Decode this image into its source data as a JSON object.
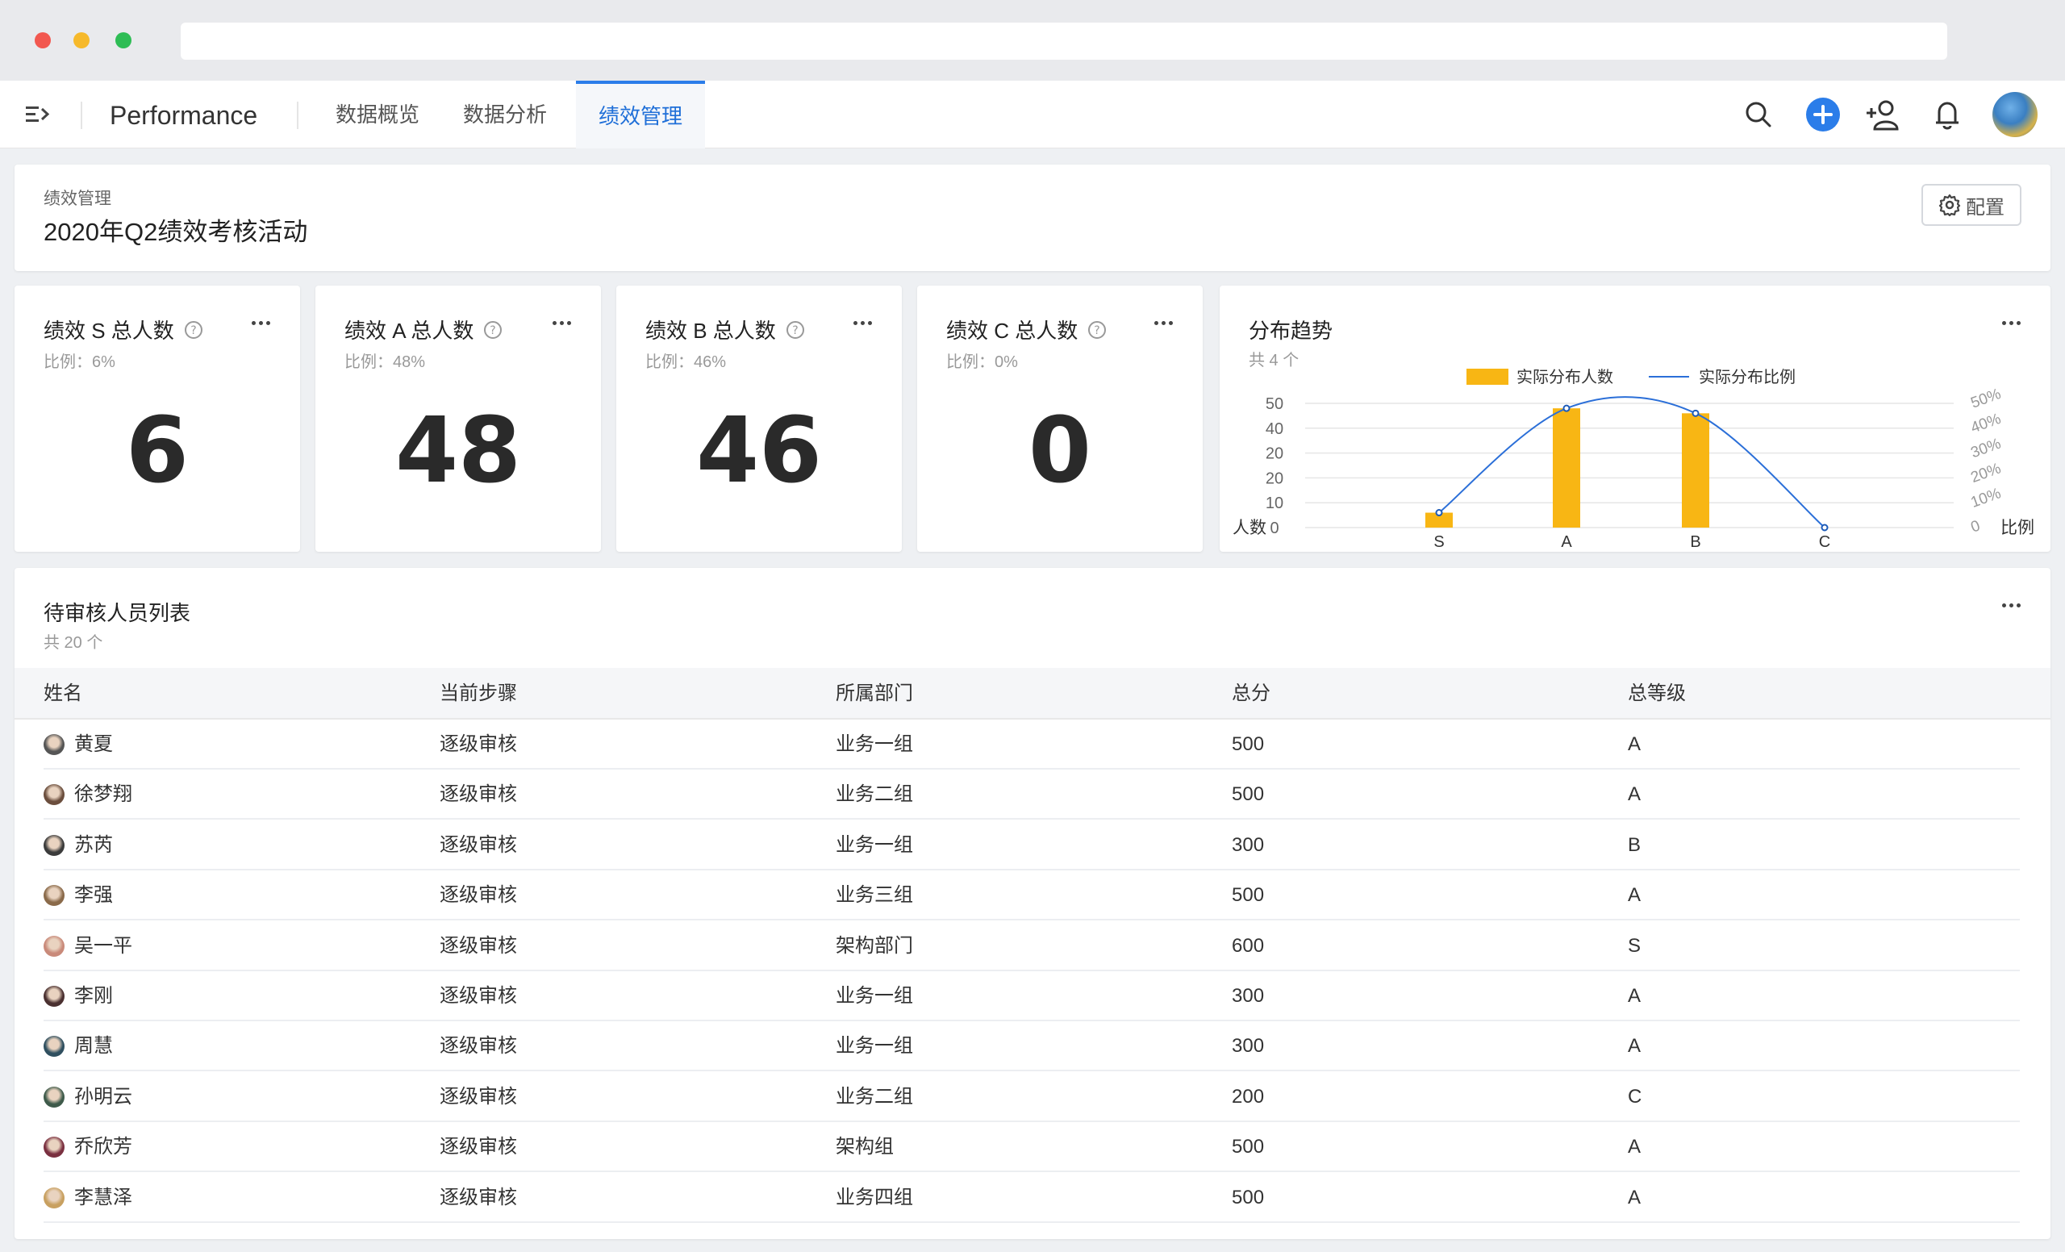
{
  "nav": {
    "brand": "Performance",
    "tabs": [
      {
        "label": "数据概览"
      },
      {
        "label": "数据分析"
      },
      {
        "label": "绩效管理",
        "active": true
      }
    ],
    "icons": [
      "search-icon",
      "add-icon",
      "add-user-icon",
      "bell-icon",
      "user-avatar"
    ]
  },
  "header": {
    "breadcrumb": "绩效管理",
    "title": "2020年Q2绩效考核活动",
    "config_label": "配置"
  },
  "stats": [
    {
      "title": "绩效 S 总人数",
      "sub": "比例：6%",
      "value": "6"
    },
    {
      "title": "绩效 A 总人数",
      "sub": "比例：48%",
      "value": "48"
    },
    {
      "title": "绩效 B 总人数",
      "sub": "比例：46%",
      "value": "46"
    },
    {
      "title": "绩效 C 总人数",
      "sub": "比例：0%",
      "value": "0"
    }
  ],
  "chart_card": {
    "title": "分布趋势",
    "sub": "共 4 个"
  },
  "chart_data": {
    "type": "bar",
    "categories": [
      "S",
      "A",
      "B",
      "C"
    ],
    "series": [
      {
        "name": "实际分布人数",
        "type": "bar",
        "values": [
          6,
          48,
          46,
          0
        ],
        "color": "#f8b614",
        "axis": "left"
      },
      {
        "name": "实际分布比例",
        "type": "line",
        "values": [
          0.06,
          0.48,
          0.46,
          0
        ],
        "color": "#2b6fd8",
        "axis": "right"
      }
    ],
    "ylabel": "人数",
    "y2label": "比例",
    "ylim": [
      0,
      50
    ],
    "yticks": [
      "0",
      "10",
      "20",
      "20",
      "40",
      "50"
    ],
    "y2lim": [
      0,
      0.5
    ],
    "y2ticks": [
      "0",
      "10%",
      "20%",
      "30%",
      "40%",
      "50%"
    ],
    "legend": "top-center",
    "grid": true
  },
  "table": {
    "title": "待审核人员列表",
    "sub": "共 20 个",
    "columns": [
      "姓名",
      "当前步骤",
      "所属部门",
      "总分",
      "总等级"
    ],
    "rows": [
      {
        "name": "黄夏",
        "step": "逐级审核",
        "dept": "业务一组",
        "score": "500",
        "grade": "A"
      },
      {
        "name": "徐梦翔",
        "step": "逐级审核",
        "dept": "业务二组",
        "score": "500",
        "grade": "A"
      },
      {
        "name": "苏芮",
        "step": "逐级审核",
        "dept": "业务一组",
        "score": "300",
        "grade": "B"
      },
      {
        "name": "李强",
        "step": "逐级审核",
        "dept": "业务三组",
        "score": "500",
        "grade": "A"
      },
      {
        "name": "吴一平",
        "step": "逐级审核",
        "dept": "架构部门",
        "score": "600",
        "grade": "S"
      },
      {
        "name": "李刚",
        "step": "逐级审核",
        "dept": "业务一组",
        "score": "300",
        "grade": "A"
      },
      {
        "name": "周慧",
        "step": "逐级审核",
        "dept": "业务一组",
        "score": "300",
        "grade": "A"
      },
      {
        "name": "孙明云",
        "step": "逐级审核",
        "dept": "业务二组",
        "score": "200",
        "grade": "C"
      },
      {
        "name": "乔欣芳",
        "step": "逐级审核",
        "dept": "架构组",
        "score": "500",
        "grade": "A"
      },
      {
        "name": "李慧泽",
        "step": "逐级审核",
        "dept": "业务四组",
        "score": "500",
        "grade": "A"
      }
    ]
  }
}
